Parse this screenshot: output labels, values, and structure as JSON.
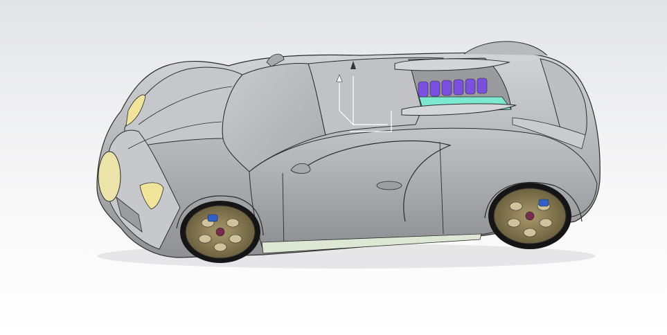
{
  "viewport": {
    "model": "sports-car-cad-model",
    "render_style": "shaded-with-edges",
    "background_top": "#e3e4e6",
    "background_bottom": "#ffffff"
  },
  "colors": {
    "body": "#b5b6b9",
    "edge": "#2b2b2b",
    "headlight": "#f0e49a",
    "grille": "#ece3a8",
    "engine_cylinder": "#7b4fe0",
    "engine_cover": "#7de8d0",
    "wheel_rim": "#8c7b4f",
    "brake": "#2f5fc8",
    "tire": "#151515"
  }
}
